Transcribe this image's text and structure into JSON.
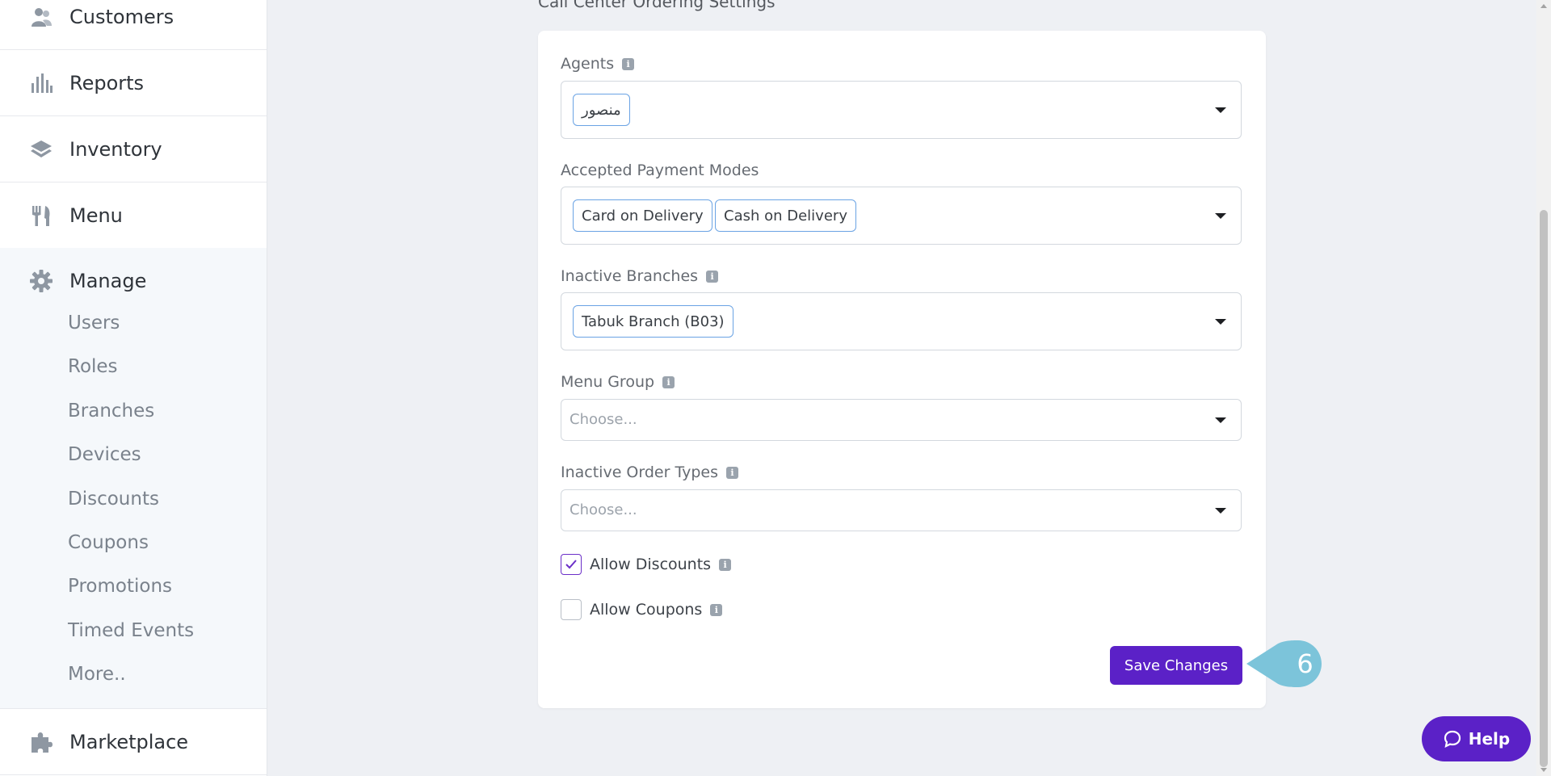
{
  "sidebar": {
    "items": [
      {
        "label": "Customers",
        "icon": "customers-icon"
      },
      {
        "label": "Reports",
        "icon": "bar-chart-icon"
      },
      {
        "label": "Inventory",
        "icon": "layers-icon"
      },
      {
        "label": "Menu",
        "icon": "fork-knife-icon"
      }
    ],
    "manage": {
      "label": "Manage",
      "icon": "gear-icon",
      "subitems": [
        "Users",
        "Roles",
        "Branches",
        "Devices",
        "Discounts",
        "Coupons",
        "Promotions",
        "Timed Events",
        "More.."
      ]
    },
    "marketplace": {
      "label": "Marketplace",
      "icon": "puzzle-icon"
    }
  },
  "main": {
    "section_title": "Call Center Ordering Settings",
    "fields": {
      "agents": {
        "label": "Agents",
        "tags": [
          "منصور"
        ]
      },
      "payment_modes": {
        "label": "Accepted Payment Modes",
        "tags": [
          "Card on Delivery",
          "Cash on Delivery"
        ]
      },
      "inactive_branches": {
        "label": "Inactive Branches",
        "tags": [
          "Tabuk Branch (B03)"
        ]
      },
      "menu_group": {
        "label": "Menu Group",
        "placeholder": "Choose..."
      },
      "inactive_order_types": {
        "label": "Inactive Order Types",
        "placeholder": "Choose..."
      }
    },
    "allow_discounts": {
      "label": "Allow Discounts",
      "checked": true
    },
    "allow_coupons": {
      "label": "Allow Coupons",
      "checked": false
    },
    "save_label": "Save Changes",
    "step_number": "6"
  },
  "help": {
    "label": "Help"
  },
  "colors": {
    "accent": "#5b21c7",
    "tag_border": "#6aa3e4",
    "step_bubble": "#7cc4da"
  }
}
